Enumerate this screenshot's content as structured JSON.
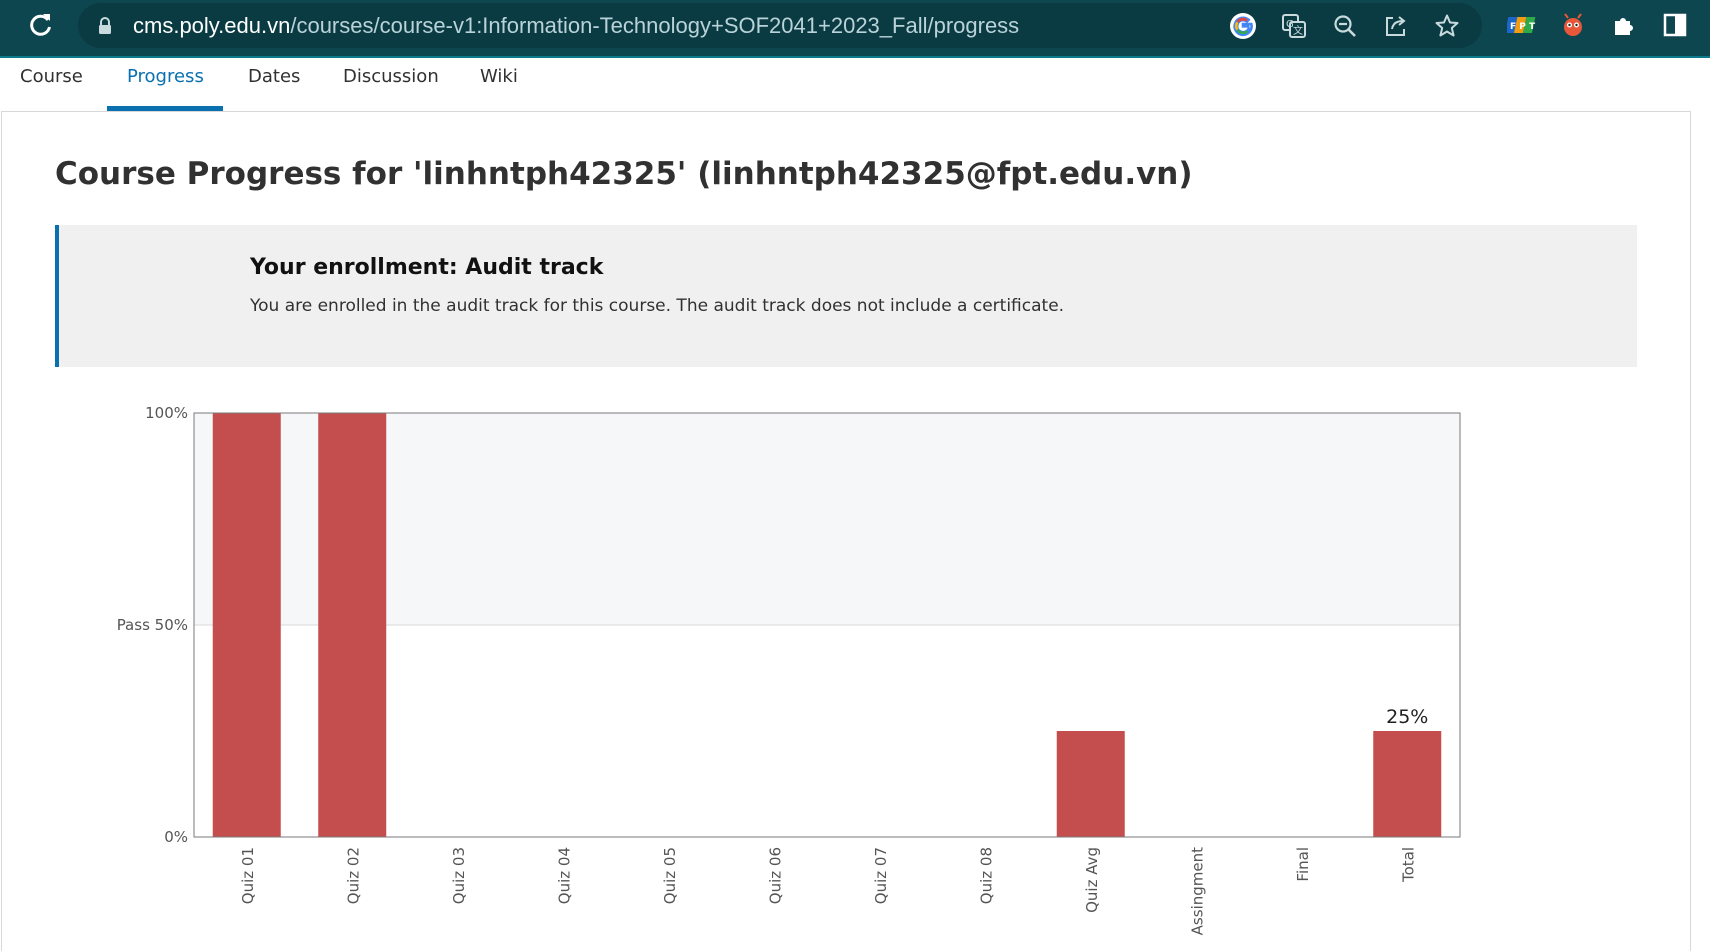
{
  "browser": {
    "url_host": "cms.poly.edu.vn",
    "url_path": "/courses/course-v1:Information-Technology+SOF2041+2023_Fall/progress",
    "icons": [
      "reload-icon",
      "lock-icon",
      "google-icon",
      "translate-icon",
      "zoom-icon",
      "share-icon",
      "bookmark-star-icon",
      "fpt-extension-icon",
      "bug-extension-icon",
      "extensions-puzzle-icon",
      "sidepanel-icon"
    ]
  },
  "tabs": [
    {
      "label": "Course",
      "active": false
    },
    {
      "label": "Progress",
      "active": true
    },
    {
      "label": "Dates",
      "active": false
    },
    {
      "label": "Discussion",
      "active": false
    },
    {
      "label": "Wiki",
      "active": false
    }
  ],
  "page": {
    "title": "Course Progress for 'linhntph42325' (linhntph42325@fpt.edu.vn)"
  },
  "enrollment": {
    "title": "Your enrollment: Audit track",
    "text": "You are enrolled in the audit track for this course. The audit track does not include a certificate."
  },
  "colors": {
    "browser_bar": "#0e4650",
    "accent": "#0a70b0",
    "bar": "#c44d4e",
    "banner_bg": "#f0f0f0",
    "pass_region": "#f6f7f9"
  },
  "chart_data": {
    "type": "bar",
    "categories": [
      "Quiz 01",
      "Quiz 02",
      "Quiz 03",
      "Quiz 04",
      "Quiz 05",
      "Quiz 06",
      "Quiz 07",
      "Quiz 08",
      "Quiz Avg",
      "Assingment",
      "Final",
      "Total"
    ],
    "values": [
      100,
      100,
      0,
      0,
      0,
      0,
      0,
      0,
      25,
      0,
      0,
      25
    ],
    "ylim": [
      0,
      100
    ],
    "y_ticks": [
      {
        "value": 0,
        "label": "0%"
      },
      {
        "value": 50,
        "label": "Pass 50%"
      },
      {
        "value": 100,
        "label": "100%"
      }
    ],
    "pass_threshold": 50,
    "annotations": [
      {
        "category": "Total",
        "label": "25%"
      }
    ],
    "grid": false
  }
}
